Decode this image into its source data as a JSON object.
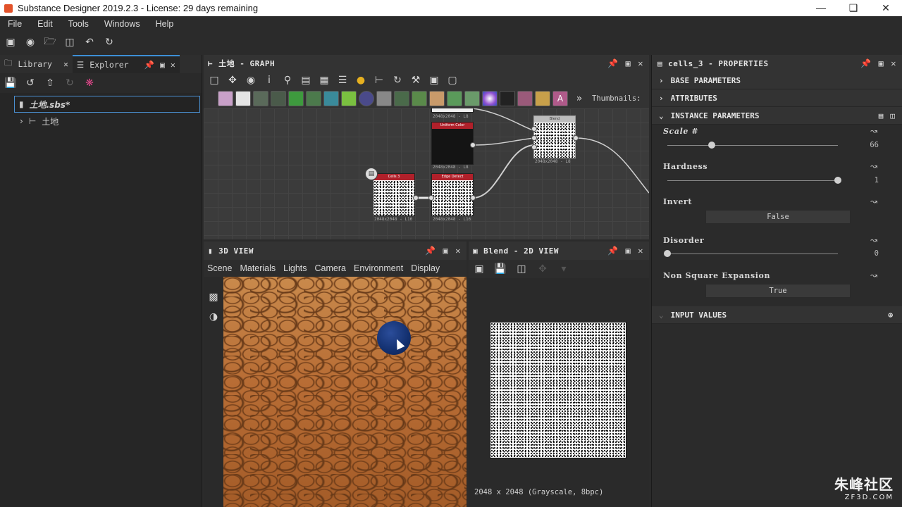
{
  "window": {
    "title": "Substance Designer 2019.2.3 - License: 29 days remaining"
  },
  "menu": [
    "File",
    "Edit",
    "Tools",
    "Windows",
    "Help"
  ],
  "left_panel": {
    "tabs": [
      {
        "label": "Library",
        "active": false
      },
      {
        "label": "Explorer",
        "active": true
      }
    ],
    "tree": [
      {
        "label": "土地.sbs*",
        "selected": true
      },
      {
        "label": "土地",
        "selected": false
      }
    ]
  },
  "graph": {
    "title": "土地 - GRAPH",
    "thumbnails_label": "Thumbnails:",
    "nodes": [
      {
        "title": "Uniform Color",
        "res": "2048x2048 - L8"
      },
      {
        "title": "Cells 3",
        "res": "2048x2048 - L16"
      },
      {
        "title": "Edge Detect",
        "res": "2048x2048 - L16"
      },
      {
        "title": "Blend",
        "res": "2048x2048 - L8"
      }
    ]
  },
  "view3d": {
    "title": "3D VIEW",
    "menu": [
      "Scene",
      "Materials",
      "Lights",
      "Camera",
      "Environment",
      "Display"
    ]
  },
  "view2d": {
    "title": "Blend - 2D VIEW",
    "status": "2048 x 2048 (Grayscale, 8bpc)"
  },
  "properties": {
    "title": "cells_3 - PROPERTIES",
    "sections": [
      "BASE PARAMETERS",
      "ATTRIBUTES",
      "INSTANCE PARAMETERS",
      "INPUT VALUES"
    ],
    "params": [
      {
        "label": "Scale #",
        "type": "slider",
        "value": "66",
        "fraction": 0.26
      },
      {
        "label": "Hardness",
        "type": "slider",
        "value": "1",
        "fraction": 1.0
      },
      {
        "label": "Invert",
        "type": "button",
        "value": "False"
      },
      {
        "label": "Disorder",
        "type": "slider",
        "value": "0",
        "fraction": 0.0
      },
      {
        "label": "Non Square Expansion",
        "type": "button",
        "value": "True"
      }
    ]
  },
  "watermark": {
    "cn": "朱峰社区",
    "en": "ZF3D.COM"
  },
  "colors": {
    "accent": "#3d8fd6",
    "node_header": "#b0202a",
    "panel": "#2b2b2b"
  }
}
